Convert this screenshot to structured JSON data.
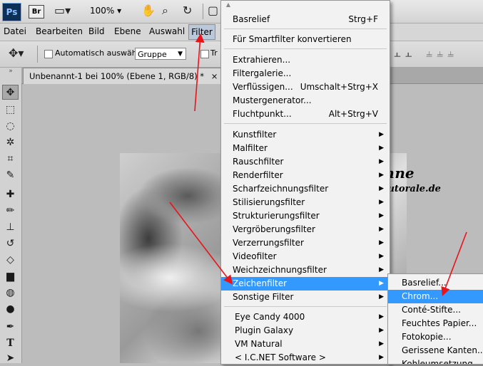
{
  "app": {
    "logo": "Ps",
    "bridge": "Br",
    "zoom": "100%"
  },
  "menubar": {
    "items": [
      "Datei",
      "Bearbeiten",
      "Bild",
      "Ebene",
      "Auswahl",
      "Filter"
    ]
  },
  "options": {
    "auto_select_label": "Automatisch auswählen:",
    "auto_select_value": "Gruppe",
    "transform_label": "Tr"
  },
  "document": {
    "tab_title": "Unbenannt-1 bei 100% (Ebene 1, RGB/8) *",
    "close": "×"
  },
  "watermark": {
    "line1": "© by Bohne",
    "line2": "www.bohnes-tutorale.de"
  },
  "filter_menu": {
    "top_arrow": "▲",
    "last_filter": {
      "label": "Basrelief",
      "shortcut": "Strg+F"
    },
    "smart": "Für Smartfilter konvertieren",
    "group2": [
      {
        "label": "Extrahieren...",
        "shortcut": ""
      },
      {
        "label": "Filtergalerie...",
        "shortcut": ""
      },
      {
        "label": "Verflüssigen...",
        "shortcut": "Umschalt+Strg+X"
      },
      {
        "label": "Mustergenerator...",
        "shortcut": ""
      },
      {
        "label": "Fluchtpunkt...",
        "shortcut": "Alt+Strg+V"
      }
    ],
    "group3": [
      "Kunstfilter",
      "Malfilter",
      "Rauschfilter",
      "Renderfilter",
      "Scharfzeichnungsfilter",
      "Stilisierungsfilter",
      "Strukturierungsfilter",
      "Vergröberungsfilter",
      "Verzerrungsfilter",
      "Videofilter",
      "Weichzeichnungsfilter",
      "Zeichenfilter",
      "Sonstige Filter"
    ],
    "highlighted": "Zeichenfilter",
    "group4": [
      "Eye Candy 4000",
      "Plugin Galaxy",
      "VM Natural",
      "< I.C.NET Software >"
    ],
    "submenu_arrow": "▶"
  },
  "submenu": {
    "items": [
      "Basrelief...",
      "Chrom...",
      "Conté-Stifte...",
      "Feuchtes Papier...",
      "Fotokopie...",
      "Gerissene Kanten...",
      "Kohleumsetzung..."
    ],
    "highlighted": "Chrom..."
  },
  "colors": {
    "highlight": "#3399ff",
    "annotation_arrow": "#e8141b"
  }
}
